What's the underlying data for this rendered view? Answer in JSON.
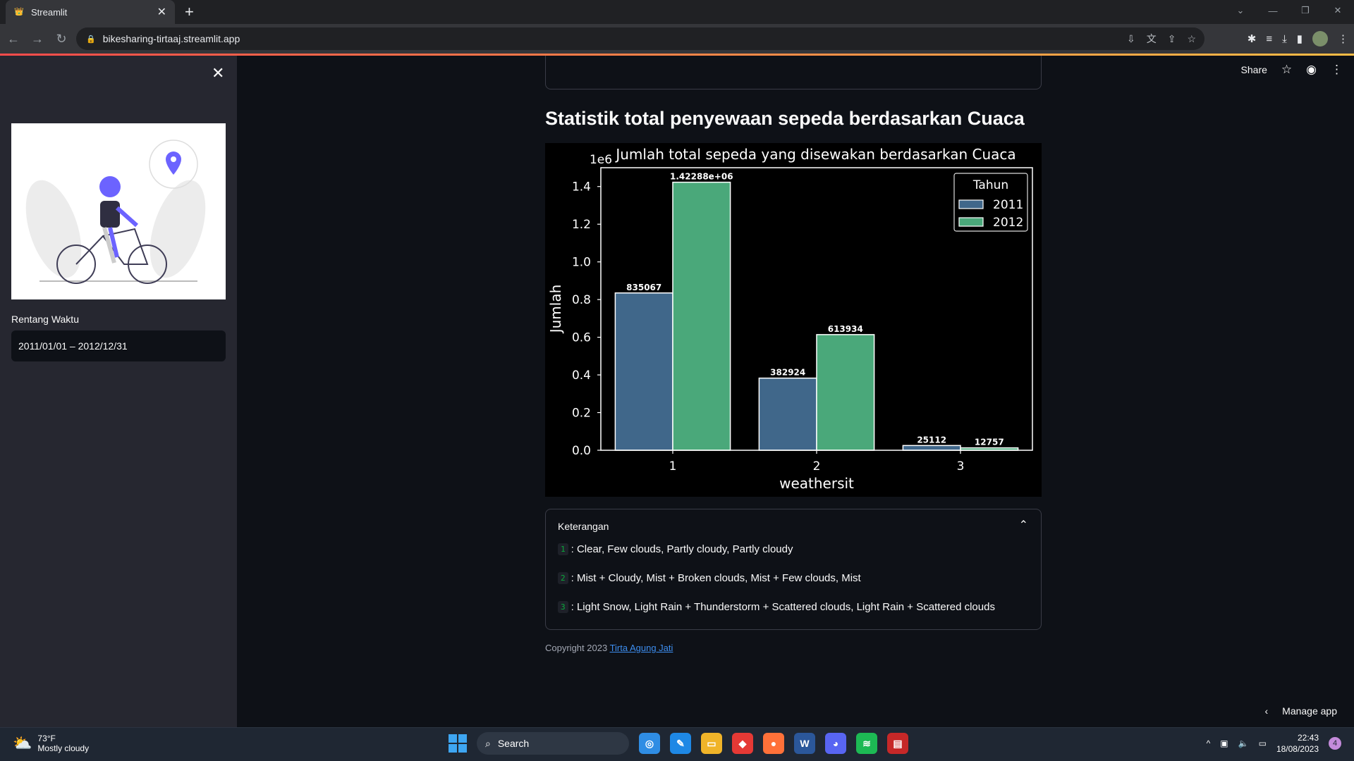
{
  "browser": {
    "tab_title": "Streamlit",
    "url": "bikesharing-tirtaaj.streamlit.app",
    "new_tab": "+",
    "tab_close": "✕"
  },
  "sidebar": {
    "close": "✕",
    "date_label": "Rentang Waktu",
    "date_value": "2011/01/01 – 2012/12/31"
  },
  "header": {
    "share": "Share"
  },
  "main": {
    "title": "Statistik total penyewaan sepeda berdasarkan Cuaca",
    "expander_title": "Keterangan",
    "items": [
      {
        "code": "1",
        "text": ": Clear, Few clouds, Partly cloudy, Partly cloudy"
      },
      {
        "code": "2",
        "text": ": Mist + Cloudy, Mist + Broken clouds, Mist + Few clouds, Mist"
      },
      {
        "code": "3",
        "text": ": Light Snow, Light Rain + Thunderstorm + Scattered clouds, Light Rain + Scattered clouds"
      }
    ],
    "footer_text": "Copyright 2023",
    "footer_link": "Tirta Agung Jati",
    "manage_app": "Manage app"
  },
  "chart_data": {
    "type": "bar",
    "title": "Jumlah total sepeda yang disewakan berdasarkan Cuaca",
    "xlabel": "weathersit",
    "ylabel": "Jumlah",
    "offset_label": "1e6",
    "categories": [
      "1",
      "2",
      "3"
    ],
    "series": [
      {
        "name": "2011",
        "values": [
          835067,
          382924,
          25112
        ],
        "labels": [
          "835067",
          "382924",
          "25112"
        ],
        "color": "#40678a"
      },
      {
        "name": "2012",
        "values": [
          1422880,
          613934,
          12757
        ],
        "labels": [
          "1.42288e+06",
          "613934",
          "12757"
        ],
        "color": "#4aa87a"
      }
    ],
    "legend_title": "Tahun",
    "legend_position": "top-right",
    "ylim": [
      0,
      1500000
    ],
    "yticks": [
      0,
      200000,
      400000,
      600000,
      800000,
      1000000,
      1200000,
      1400000
    ],
    "ytick_labels": [
      "0.0",
      "0.2",
      "0.4",
      "0.6",
      "0.8",
      "1.0",
      "1.2",
      "1.4"
    ],
    "grid": false,
    "background": "#000000"
  },
  "taskbar": {
    "temp": "73°F",
    "weather": "Mostly cloudy",
    "search": "Search",
    "time": "22:43",
    "date": "18/08/2023",
    "notif_count": "4"
  }
}
